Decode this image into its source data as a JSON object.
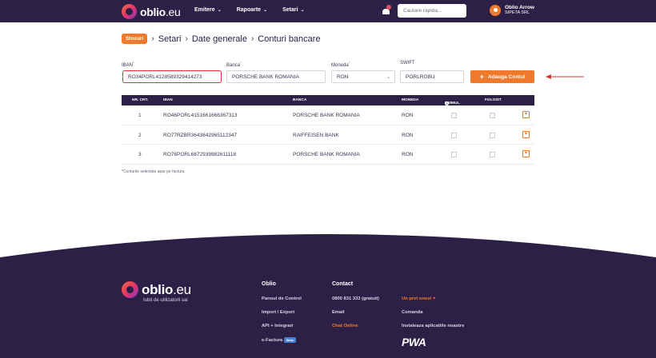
{
  "navbar": {
    "logo_main": "oblio",
    "logo_tld": ".eu",
    "menu": [
      {
        "label": "Emitere"
      },
      {
        "label": "Rapoarte"
      },
      {
        "label": "Setari"
      }
    ],
    "search_placeholder": "Cautare rapida...",
    "user_name": "Oblio Arrow",
    "user_company": "SIPETA SRL"
  },
  "breadcrumb": {
    "badge": "Stocuri",
    "items": [
      "Setari",
      "Date generale",
      "Conturi bancare"
    ]
  },
  "form": {
    "iban_label": "IBAN",
    "iban_value": "RO34PORL4128589329414273",
    "bank_label": "Banca",
    "bank_value": "PORSCHE BANK ROMANIA",
    "currency_label": "Moneda",
    "currency_value": "RON",
    "swift_label": "SWIFT",
    "swift_value": "PORLROBU",
    "add_button": "Adauga Contul",
    "required_mark": "*"
  },
  "table": {
    "headers": {
      "nr": "NR. CRT.",
      "iban": "IBAN",
      "bank": "BANCA",
      "currency": "MONEDA",
      "primary": "PRIMUL",
      "used": "FOLOSIT"
    },
    "rows": [
      {
        "nr": "1",
        "iban": "RO46PORL4151661666367313",
        "bank": "PORSCHE BANK ROMANIA",
        "currency": "RON"
      },
      {
        "nr": "2",
        "iban": "RO77RZBR3643842965112347",
        "bank": "RAIFFEISEN BANK",
        "currency": "RON"
      },
      {
        "nr": "3",
        "iban": "RO76PORL6872939982611118",
        "bank": "PORSCHE BANK ROMANIA",
        "currency": "RON"
      }
    ],
    "note": "*Conturile selectate apar pe factura"
  },
  "footer": {
    "logo_main": "oblio",
    "logo_tld": ".eu",
    "tagline": "Iubit de utilizatorii sai",
    "col1_title": "Oblio",
    "col1_links": [
      "Panoul de Control",
      "Import / Export",
      "API + Integrari",
      "e-Factura"
    ],
    "beta": "Beta",
    "col2_title": "Contact",
    "phone": "0800 831 333 (gratuit)",
    "email": "Email",
    "chat": "Chat Online",
    "col3_links": [
      "Un pret onest",
      "Comanda",
      "Instaleaza aplicatiile noastre"
    ],
    "pwa": "PWA"
  },
  "colors": {
    "navy": "#2c2046",
    "accent": "#f07a2c",
    "highlight_border": "#d9342f"
  }
}
